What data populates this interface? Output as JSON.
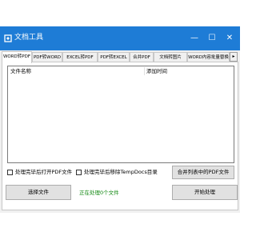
{
  "window": {
    "title": "文档工具",
    "minimize_glyph": "—",
    "maximize_glyph": "☐",
    "close_glyph": "✕",
    "titlebar_color": "#1e7cd6"
  },
  "tabs": [
    {
      "label": "WORD转PDF",
      "active": true
    },
    {
      "label": "PDF转WORD",
      "active": false
    },
    {
      "label": "EXCEL转PDF",
      "active": false
    },
    {
      "label": "PDF转EXCEL",
      "active": false
    },
    {
      "label": "合并PDF",
      "active": false
    },
    {
      "label": "文档转图片",
      "active": false
    },
    {
      "label": "WORD内容批量替换",
      "active": false
    }
  ],
  "tab_scroll_glyph": "▸",
  "list": {
    "columns": [
      "文件名称",
      "添加时间"
    ],
    "rows": []
  },
  "options": {
    "open_after_done": "处理完毕后打开PDF文件",
    "move_to_temp": "处理完毕后移除TempDocs目录"
  },
  "buttons": {
    "merge_list_pdf": "合并列表中的PDF文件",
    "select_files": "选择文件",
    "start": "开始处理"
  },
  "status": {
    "text": "正在处理0个文件",
    "color": "#118811"
  }
}
